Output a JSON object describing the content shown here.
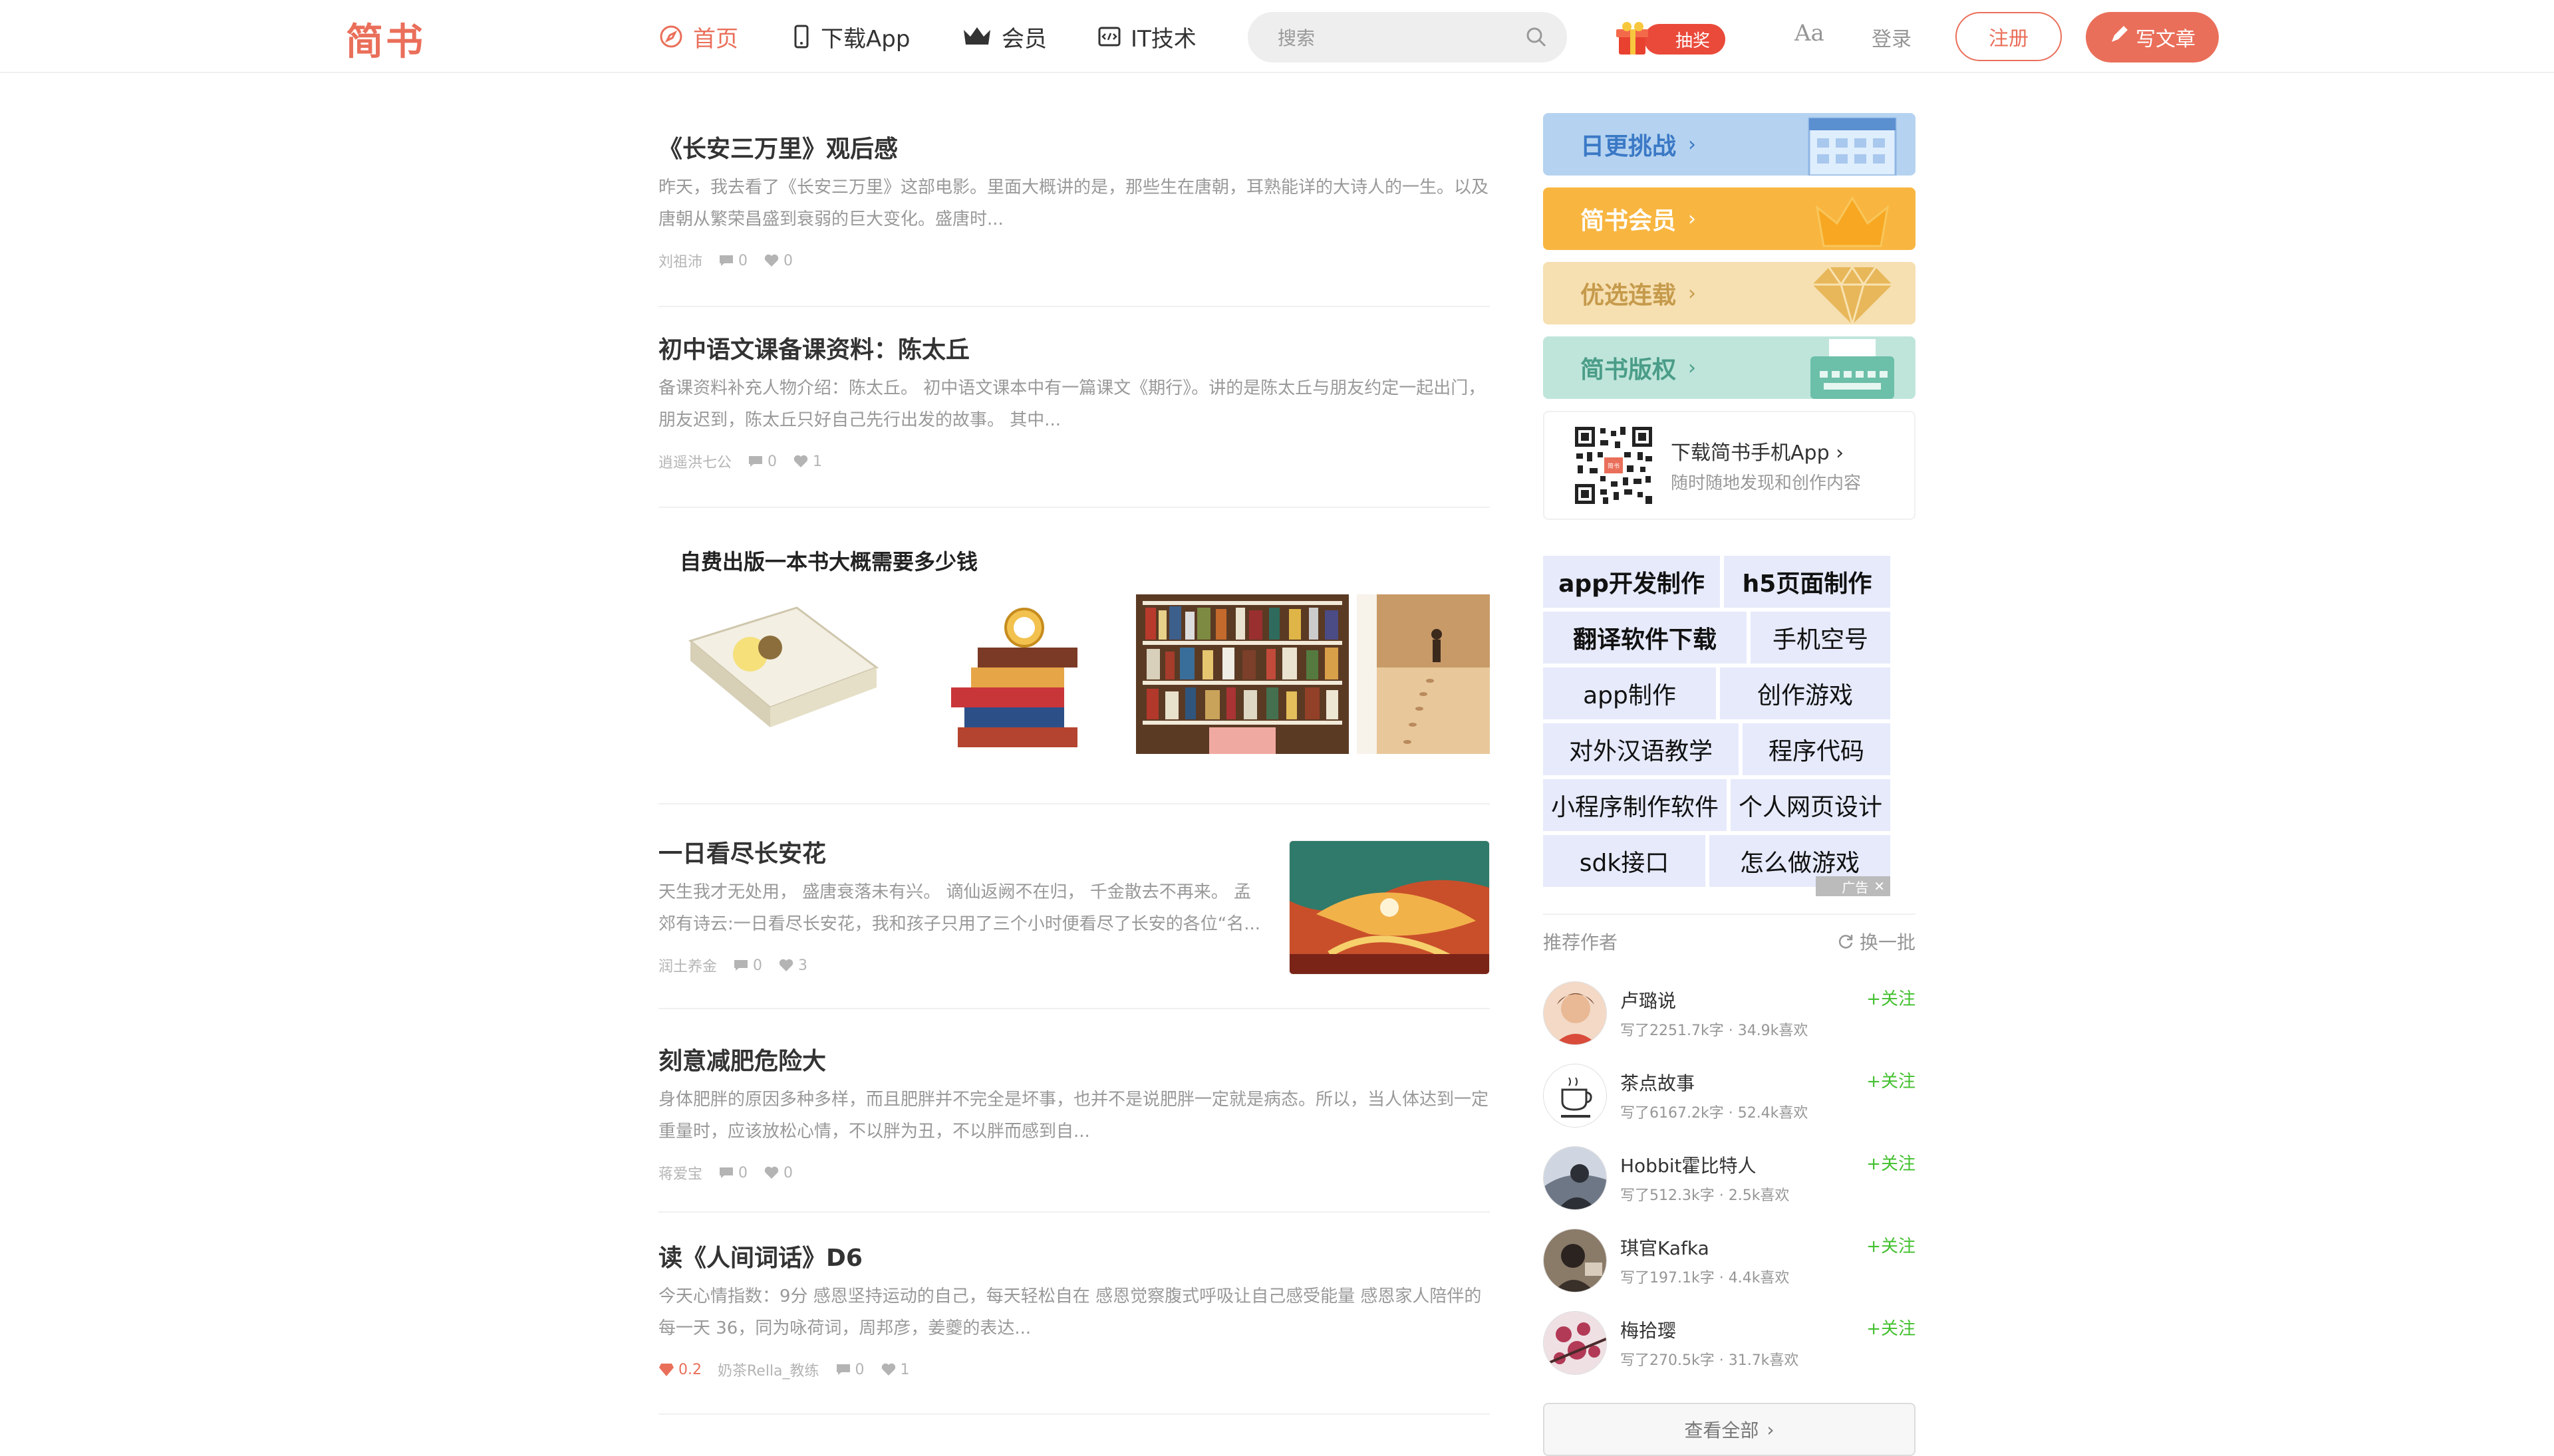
{
  "header": {
    "logo": "简书",
    "nav": [
      {
        "label": "首页",
        "icon": "compass-icon"
      },
      {
        "label": "下载App",
        "icon": "phone-icon"
      },
      {
        "label": "会员",
        "icon": "crown-icon"
      },
      {
        "label": "IT技术",
        "icon": "code-icon"
      }
    ],
    "search_placeholder": "搜索",
    "lottery_label": "抽奖",
    "font_toggle": "Aa",
    "login": "登录",
    "register": "注册",
    "write": "写文章",
    "accent_color": "#ea6f5a"
  },
  "articles": [
    {
      "title": "《长安三万里》观后感",
      "abstract": "昨天，我去看了《长安三万里》这部电影。里面大概讲的是，那些生在唐朝，耳熟能详的大诗人的一生。以及唐朝从繁荣昌盛到衰弱的巨大变化。盛唐时...",
      "author": "刘祖沛",
      "comments": "0",
      "likes": "0"
    },
    {
      "title": "初中语文课备课资料：陈太丘",
      "abstract": "备课资料补充人物介绍：陈太丘。 初中语文课本中有一篇课文《期行》。讲的是陈太丘与朋友约定一起出门，朋友迟到，陈太丘只好自己先行出发的故事。 其中...",
      "author": "逍遥洪七公",
      "comments": "0",
      "likes": "1"
    },
    {
      "type": "ad",
      "title": "自费出版一本书大概需要多少钱"
    },
    {
      "title": "一日看尽长安花",
      "abstract": "天生我才无处用， 盛唐衰落未有兴。 谪仙返阙不在归， 千金散去不再来。 孟郊有诗云:一日看尽长安花，我和孩子只用了三个小时便看尽了长安的各位“名...",
      "author": "润土养金",
      "comments": "0",
      "likes": "3"
    },
    {
      "title": "刻意减肥危险大",
      "abstract": "身体肥胖的原因多种多样，而且肥胖并不完全是坏事，也并不是说肥胖一定就是病态。所以，当人体达到一定重量时，应该放松心情，不以胖为丑，不以胖而感到自...",
      "author": "蒋爱宝",
      "comments": "0",
      "likes": "0"
    },
    {
      "title": "读《人间词话》D6",
      "abstract": "今天心情指数：9分 感恩坚持运动的自己，每天轻松自在 感恩觉察腹式呼吸让自己感受能量 感恩家人陪伴的每一天 36，同为咏荷词，周邦彦，姜夔的表达...",
      "jewel": "0.2",
      "author": "奶茶Rella_教练",
      "comments": "0",
      "likes": "1"
    }
  ],
  "sidebar": {
    "banners": [
      {
        "label": "日更挑战",
        "bg": "#b5d3f0",
        "color": "#3b79c6",
        "icon": "calendar-icon"
      },
      {
        "label": "简书会员",
        "bg": "#f8b641",
        "color": "#ffffff",
        "icon": "crown-icon"
      },
      {
        "label": "优选连载",
        "bg": "#f6dfb0",
        "color": "#c59a4b",
        "icon": "diamond-icon"
      },
      {
        "label": "简书版权",
        "bg": "#bfe5da",
        "color": "#4a9d88",
        "icon": "typewriter-icon"
      }
    ],
    "download": {
      "title": "下载简书手机App",
      "subtitle": "随时随地发现和创作内容",
      "qr_badge": "简书"
    },
    "ads": [
      "app开发制作",
      "h5页面制作",
      "翻译软件下载",
      "手机空号",
      "app制作",
      "创作游戏",
      "对外汉语教学",
      "程序代码",
      "小程序制作软件",
      "个人网页设计",
      "sdk接口",
      "怎么做游戏"
    ],
    "ad_mark": "广告",
    "recommend_title": "推荐作者",
    "refresh": "换一批",
    "follow_label": "+关注",
    "authors": [
      {
        "name": "卢璐说",
        "stats": "写了2251.7k字 · 34.9k喜欢"
      },
      {
        "name": "茶点故事",
        "stats": "写了6167.2k字 · 52.4k喜欢"
      },
      {
        "name": "Hobbit霍比特人",
        "stats": "写了512.3k字 · 2.5k喜欢"
      },
      {
        "name": "琪官Kafka",
        "stats": "写了197.1k字 · 4.4k喜欢"
      },
      {
        "name": "梅拾璎",
        "stats": "写了270.5k字 · 31.7k喜欢"
      }
    ],
    "view_all": "查看全部"
  }
}
